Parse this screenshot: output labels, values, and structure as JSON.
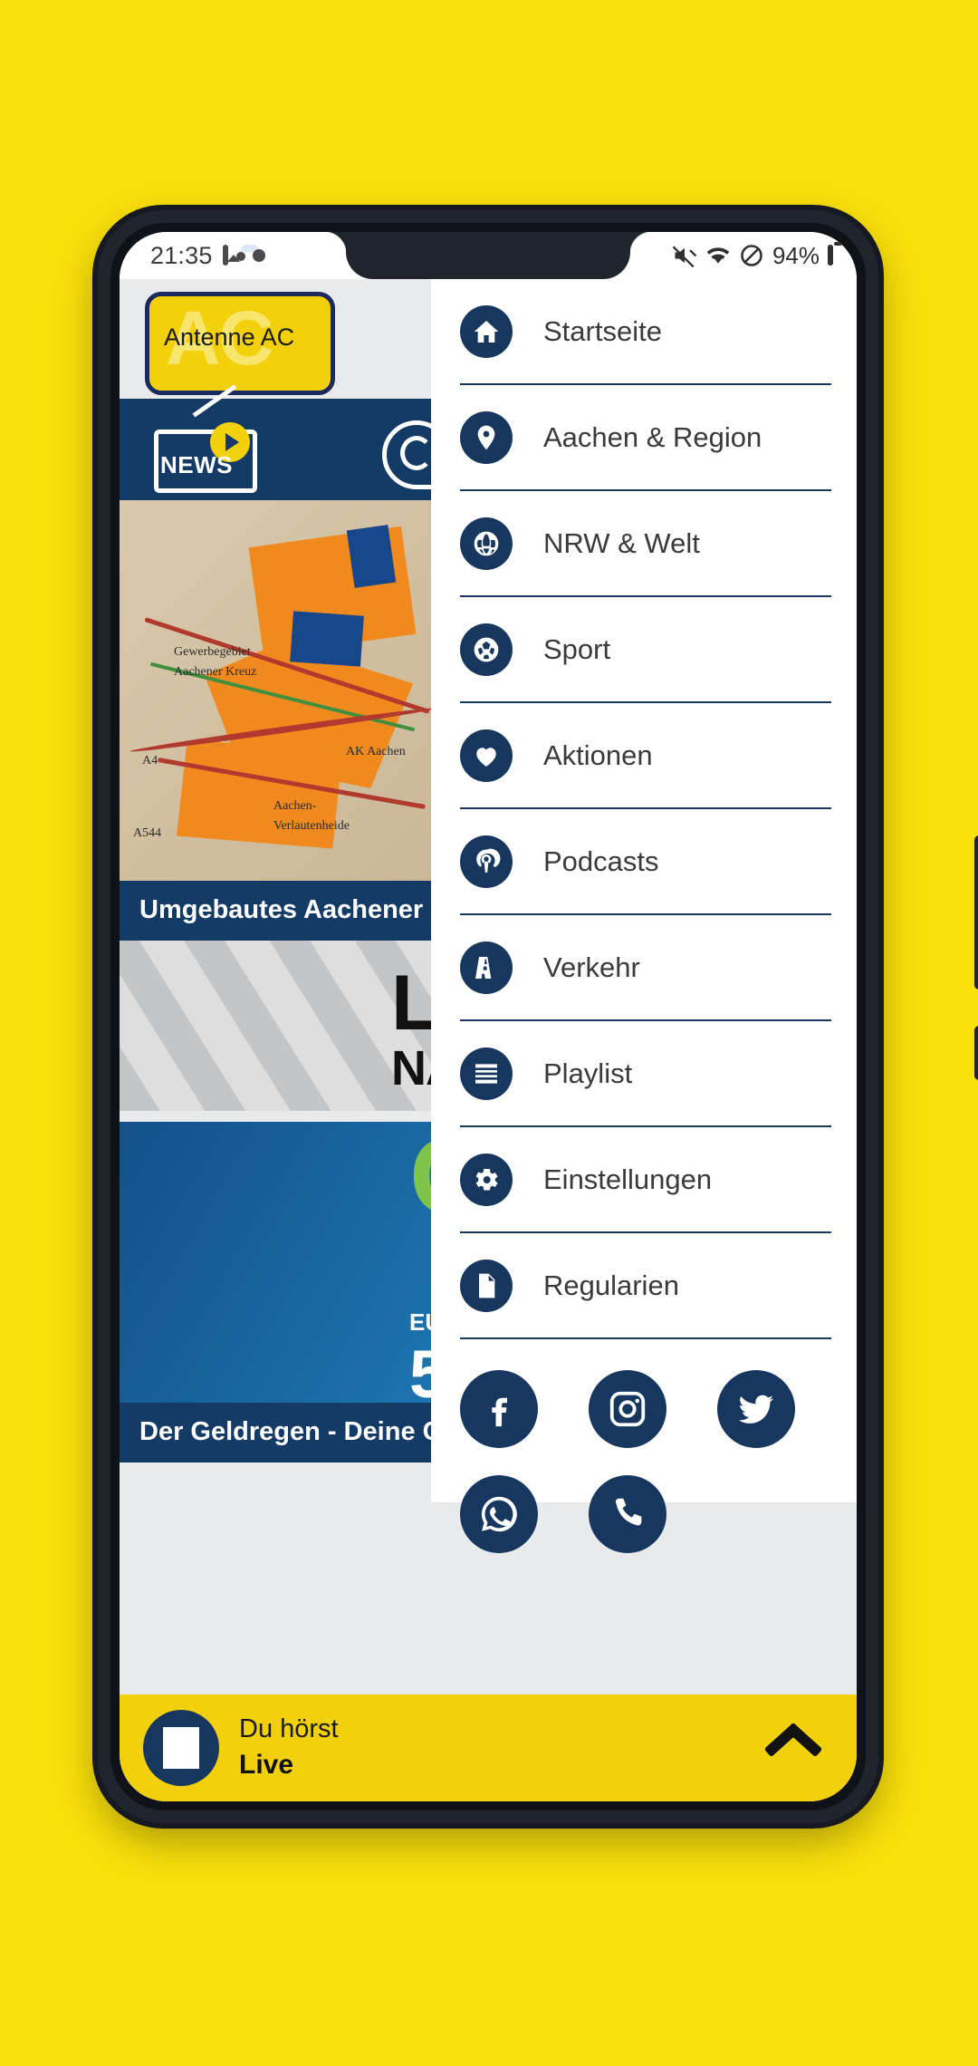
{
  "statusbar": {
    "time": "21:35",
    "battery_percent": "94%",
    "icons_left": [
      "photo-icon",
      "app-notification-icon",
      "cloud-icon",
      "dot-icon"
    ],
    "icons_right": [
      "mute-icon",
      "wifi-icon",
      "do-not-disturb-icon",
      "battery-icon"
    ]
  },
  "app": {
    "logo_text": "Antenne AC",
    "logo_ghost": "AC",
    "nav": {
      "news_label": "NEWS",
      "items": [
        "news-icon",
        "whatsapp-icon"
      ]
    },
    "cards": [
      {
        "title": "Umgebautes Aachener Kreuz",
        "image": "map-photo"
      },
      {
        "title": "LOCKDOWN NACHT",
        "image": "lockdown-banner"
      },
      {
        "title": "Der Geldregen - Deine Chance",
        "image": "geldregen-banner"
      }
    ],
    "banner2": {
      "line1": "LO",
      "line2": "NACH"
    },
    "banner3": {
      "big": "G R",
      "sub": "EU",
      "num": "5"
    }
  },
  "drawer": {
    "items": [
      {
        "label": "Startseite",
        "icon": "home-icon"
      },
      {
        "label": "Aachen & Region",
        "icon": "location-pin-icon"
      },
      {
        "label": "NRW & Welt",
        "icon": "globe-icon"
      },
      {
        "label": "Sport",
        "icon": "soccer-ball-icon"
      },
      {
        "label": "Aktionen",
        "icon": "heart-icon"
      },
      {
        "label": "Podcasts",
        "icon": "podcast-icon"
      },
      {
        "label": "Verkehr",
        "icon": "road-icon"
      },
      {
        "label": "Playlist",
        "icon": "list-icon"
      },
      {
        "label": "Einstellungen",
        "icon": "gear-icon"
      },
      {
        "label": "Regularien",
        "icon": "document-icon"
      }
    ],
    "socials": [
      {
        "name": "facebook-icon"
      },
      {
        "name": "instagram-icon"
      },
      {
        "name": "twitter-icon"
      },
      {
        "name": "whatsapp-icon"
      },
      {
        "name": "phone-icon"
      }
    ]
  },
  "player": {
    "label": "Du hörst",
    "station": "Live",
    "stop_icon": "stop-icon",
    "expand_icon": "chevron-up-icon"
  },
  "colors": {
    "brand_yellow": "#F2D00B",
    "page_yellow": "#FBE10B",
    "navy": "#17375e",
    "nav_navy": "#143a66"
  }
}
